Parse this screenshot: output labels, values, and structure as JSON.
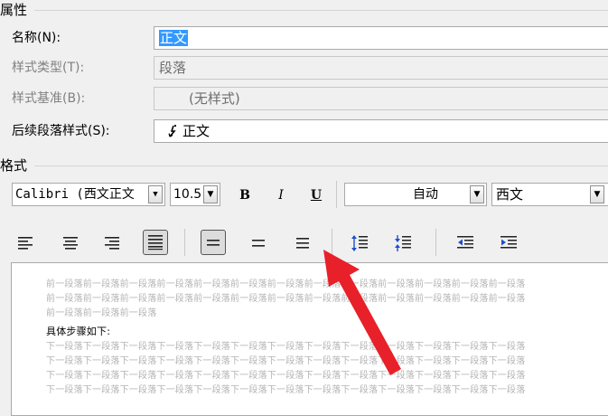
{
  "properties": {
    "section_title": "属性",
    "name_label": "名称(N):",
    "name_value": "正文",
    "style_type_label": "样式类型(T):",
    "style_type_value": "段落",
    "based_on_label": "样式基准(B):",
    "based_on_value": "(无样式)",
    "next_style_label": "后续段落样式(S):",
    "next_style_value": "正文"
  },
  "format": {
    "section_title": "格式",
    "font_value": "Calibri (西文正文",
    "size_value": "10.5",
    "bold_label": "B",
    "italic_label": "I",
    "underline_label": "U",
    "color_value": "自动",
    "script_value": "西文"
  },
  "alignment": {
    "selected": "justify",
    "line_spacing_selected": "single"
  },
  "preview": {
    "prev_line_1": "前一段落前一段落前一段落前一段落前一段落前一段落前一段落前一段落前一段落前一段落前一段落前一段落前一段落",
    "prev_line_2": "前一段落前一段落前一段落前一段落前一段落前一段落前一段落前一段落前一段落前一段落前一段落前一段落前一段落",
    "prev_line_3": "前一段落前一段落前一段落",
    "current_text": "具体步骤如下:",
    "next_line_1": "下一段落下一段落下一段落下一段落下一段落下一段落下一段落下一段落下一段落下一段落下一段落下一段落下一段落",
    "next_line_2": "下一段落下一段落下一段落下一段落下一段落下一段落下一段落下一段落下一段落下一段落下一段落下一段落下一段落",
    "next_line_3": "下一段落下一段落下一段落下一段落下一段落下一段落下一段落下一段落下一段落下一段落下一段落下一段落下一段落",
    "next_line_4": "下一段落下一段落下一段落下一段落下一段落下一段落下一段落下一段落下一段落下一段落下一段落下一段落下一段落"
  },
  "annotation": {
    "arrow_color": "#e8202a"
  }
}
